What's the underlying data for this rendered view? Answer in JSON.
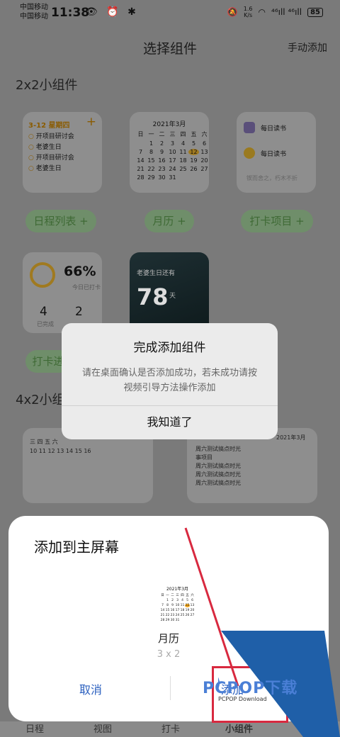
{
  "status": {
    "carrier1": "中国移动",
    "carrier2": "中国移动",
    "time": "11:38",
    "icons_left": "👁 ⏰ ✱",
    "speed_top": "1.6",
    "speed_bottom": "K/s",
    "signal": "⁴⁶ıll ⁴⁶ıll",
    "battery": "85"
  },
  "header": {
    "title": "选择组件",
    "manual_add": "手动添加"
  },
  "sections": {
    "s2x2": "2x2小组件",
    "s4x2": "4x2小组件"
  },
  "widgets": {
    "schedule": {
      "head": "3-12 星期四",
      "plus": "+",
      "items": [
        "开项目研讨会",
        "老婆生日",
        "开项目研讨会",
        "老婆生日"
      ]
    },
    "calendar": {
      "title": "2021年3月",
      "cells": [
        "日",
        "一",
        "二",
        "三",
        "四",
        "五",
        "六",
        "",
        "1",
        "2",
        "3",
        "4",
        "5",
        "6",
        "7",
        "8",
        "9",
        "10",
        "11",
        "12",
        "13",
        "14",
        "15",
        "16",
        "17",
        "18",
        "19",
        "20",
        "21",
        "22",
        "23",
        "24",
        "25",
        "26",
        "27",
        "28",
        "29",
        "30",
        "31",
        "",
        "",
        ""
      ],
      "today": "12"
    },
    "reading": {
      "row1": "每日读书",
      "row2": "每日读书",
      "foot": "锲而舍之，朽木不折"
    },
    "checkin": {
      "pct": "66%",
      "cap": "今日已打卡",
      "n1": "4",
      "c1": "已完成",
      "n2": "2"
    },
    "birthday": {
      "label": "老婆生日还有",
      "num": "78",
      "unit": "天"
    },
    "wide_left": {
      "cols": "三    四    五    六",
      "nums": "10    11    12    13    14    15    16"
    },
    "wide_right": {
      "title": "2021年3月",
      "items": [
        "周六测试搞点时光",
        "事项目",
        "周六测试搞点时光",
        "周六测试搞点时光",
        "周六测试搞点时光"
      ]
    }
  },
  "pills": {
    "p1": "日程列表 +",
    "p2": "月历 +",
    "p3": "打卡项目 +",
    "p4": "打卡进"
  },
  "dialog": {
    "title": "完成添加组件",
    "message": "请在桌面确认是否添加成功，若未成功请按视频引导方法操作添加",
    "button": "我知道了"
  },
  "sheet": {
    "title": "添加到主屏幕",
    "preview_title": "2021年3月",
    "widget_name": "月历",
    "widget_size": "3 x 2",
    "cancel": "取消",
    "add": "添加"
  },
  "nav": {
    "t1": "日程",
    "t2": "视图",
    "t3": "打卡",
    "t4": "小组件"
  },
  "watermark": {
    "text": "PCPOP下载",
    "sub": "PCPOP Download"
  },
  "colors": {
    "accent": "#2a5fbf",
    "annotation": "#d8293f",
    "today": "#f2a51a"
  }
}
